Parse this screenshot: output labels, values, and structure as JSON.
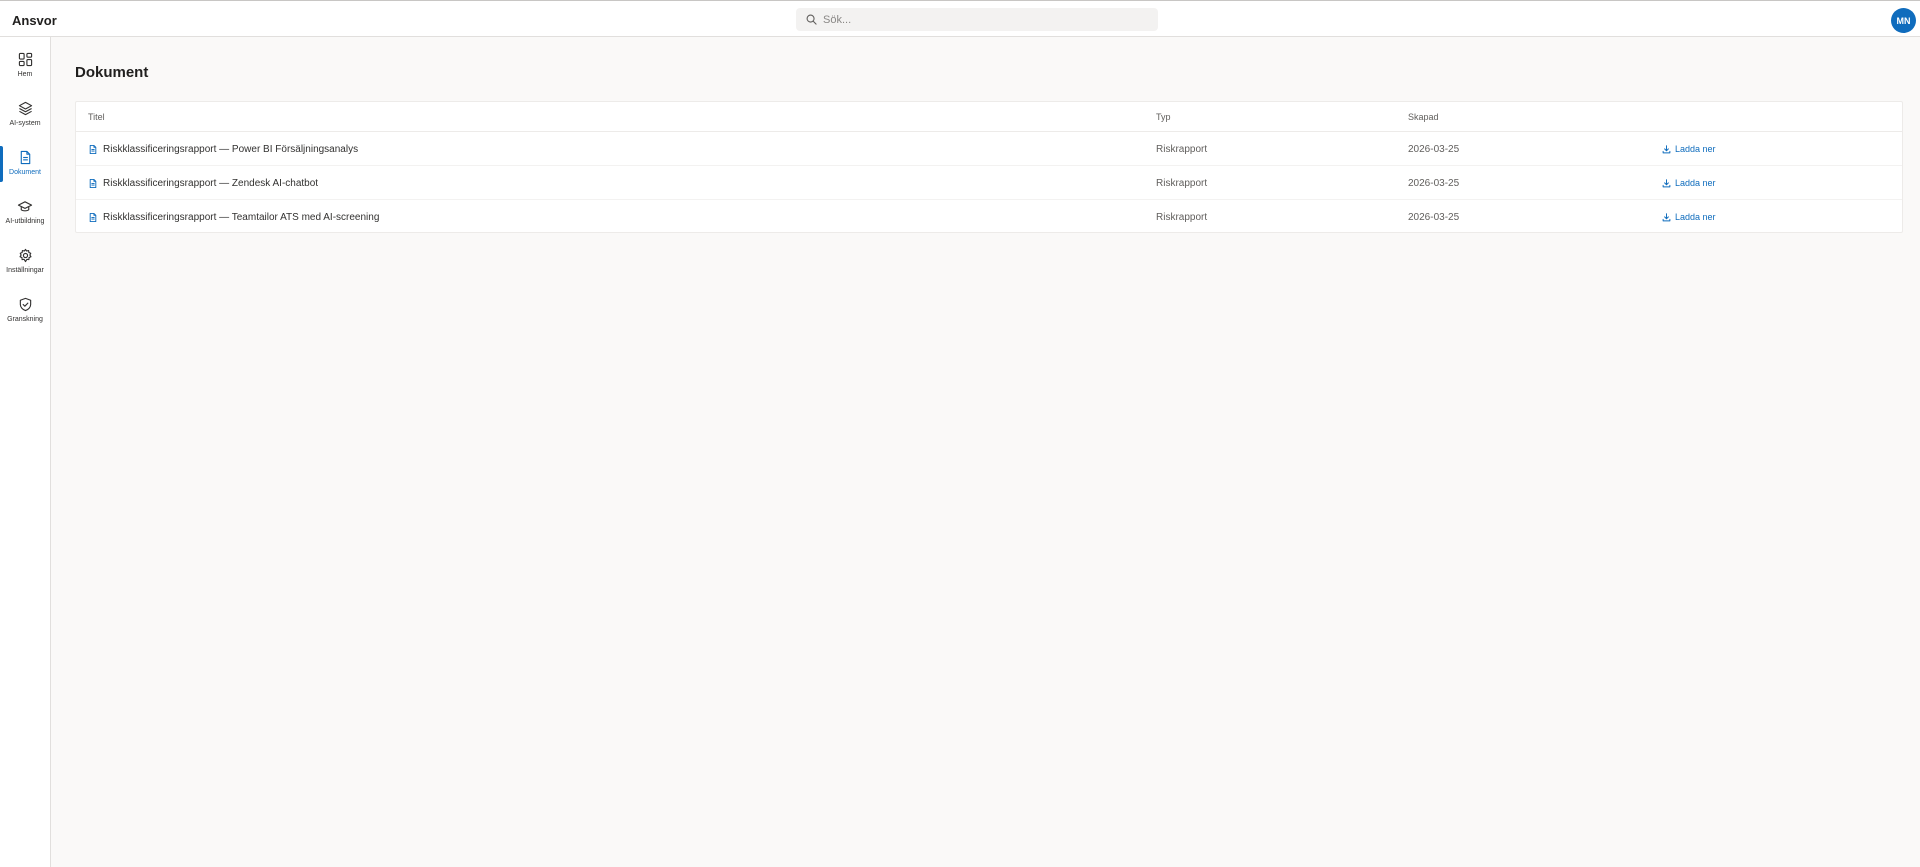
{
  "app": {
    "brand": "Ansvor"
  },
  "search": {
    "placeholder": "Sök..."
  },
  "user": {
    "initials": "MN"
  },
  "sidebar": {
    "items": [
      {
        "label": "Hem",
        "icon": "grid-icon"
      },
      {
        "label": "AI-system",
        "icon": "layers-icon"
      },
      {
        "label": "Dokument",
        "icon": "document-icon",
        "active": true
      },
      {
        "label": "AI-utbildning",
        "icon": "graduation-cap-icon"
      },
      {
        "label": "Inställningar",
        "icon": "gear-icon"
      },
      {
        "label": "Granskning",
        "icon": "shield-check-icon"
      }
    ]
  },
  "main": {
    "title": "Dokument",
    "table": {
      "columns": [
        "Titel",
        "Typ",
        "Skapad"
      ],
      "rows": [
        {
          "title": "Riskklassificeringsrapport — Power BI Försäljningsanalys",
          "type": "Riskrapport",
          "created": "2026-03-25",
          "action": "Ladda ner"
        },
        {
          "title": "Riskklassificeringsrapport — Zendesk AI-chatbot",
          "type": "Riskrapport",
          "created": "2026-03-25",
          "action": "Ladda ner"
        },
        {
          "title": "Riskklassificeringsrapport — Teamtailor ATS med AI-screening",
          "type": "Riskrapport",
          "created": "2026-03-25",
          "action": "Ladda ner"
        }
      ]
    }
  },
  "colors": {
    "accent": "#0f6cbd",
    "background": "#faf9f8"
  }
}
